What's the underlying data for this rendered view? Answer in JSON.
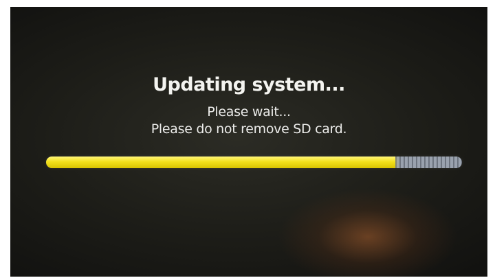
{
  "screen": {
    "title": "Updating system...",
    "line1": "Please wait...",
    "line2": "Please do not remove SD card."
  },
  "progress": {
    "fraction": 0.84,
    "fill_color": "#f3e11c",
    "track_color": "#9aa2ae"
  }
}
